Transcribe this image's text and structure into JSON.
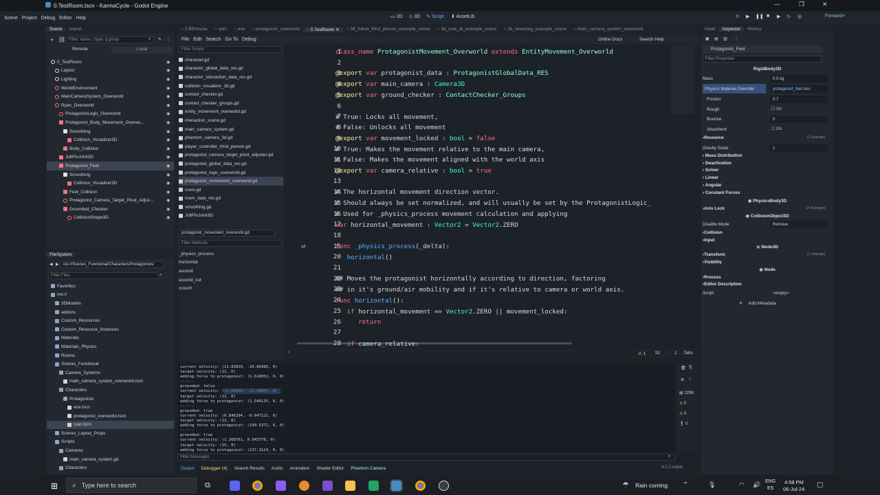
{
  "window": {
    "title": "0.TestRoom.tscn - KarmaCycle - Godot Engine"
  },
  "menu": [
    "Scene",
    "Project",
    "Debug",
    "Editor",
    "Help"
  ],
  "workspaces": [
    "2D",
    "3D",
    "Script",
    "AssetLib"
  ],
  "renderer": "Forward+",
  "scene_dock": {
    "tabs": [
      "Scene",
      "Import"
    ],
    "filter_placeholder": "Filter: name, t:type, g:group",
    "remote": "Remote",
    "local": "Local",
    "nodes": [
      {
        "label": "0_TestRoom",
        "indent": 0,
        "color": "#e0e0e0",
        "circle": true
      },
      {
        "label": "Layout",
        "indent": 1,
        "color": "#e0e0e0",
        "circle": true
      },
      {
        "label": "Lighting",
        "indent": 1,
        "color": "#e0e0e0",
        "circle": true
      },
      {
        "label": "WorldEnvironment",
        "indent": 1,
        "color": "#ff7085",
        "circle": true
      },
      {
        "label": "MainCameraSystem_Overworld",
        "indent": 1,
        "color": "#ff7085",
        "circle": true
      },
      {
        "label": "Ryan_Overworld",
        "indent": 1,
        "color": "#ff7085",
        "circle": true
      },
      {
        "label": "ProtagonistLogic_Overworld",
        "indent": 2,
        "color": "#ff7085",
        "circle": true
      },
      {
        "label": "Protagonist_Body_Movement_Overwo...",
        "indent": 2,
        "color": "#ff7085",
        "circle": false
      },
      {
        "label": "Smoothing",
        "indent": 3,
        "color": "#e0e0e0",
        "circle": false
      },
      {
        "label": "Collision_Visualizer3D",
        "indent": 4,
        "color": "#ff7085",
        "circle": false
      },
      {
        "label": "Body_Collision",
        "indent": 3,
        "color": "#ff7085",
        "circle": false
      },
      {
        "label": "JoltPinJoint3D",
        "indent": 2,
        "color": "#ff7085",
        "circle": false
      },
      {
        "label": "Protagonist_Feet",
        "indent": 2,
        "color": "#ff7085",
        "circle": false,
        "selected": true
      },
      {
        "label": "Smoothing",
        "indent": 3,
        "color": "#e0e0e0",
        "circle": false
      },
      {
        "label": "Collision_Visualizer3D",
        "indent": 4,
        "color": "#ff7085",
        "circle": false
      },
      {
        "label": "Feet_Collision",
        "indent": 3,
        "color": "#ff7085",
        "circle": false
      },
      {
        "label": "Protagonist_Camera_Target_Pivot_Adjus...",
        "indent": 3,
        "color": "#ff7085",
        "circle": true
      },
      {
        "label": "Grounded_Checker",
        "indent": 3,
        "color": "#ff7085",
        "circle": false
      },
      {
        "label": "CollisionShape3D",
        "indent": 4,
        "color": "#ff7085",
        "circle": true
      }
    ]
  },
  "filesystem": {
    "tab": "FileSystem",
    "path": "res://Scenes_Functional/Characters/Protagonists/",
    "filter_placeholder": "Filter Files",
    "items": [
      {
        "label": "Favorites:",
        "indent": 0
      },
      {
        "label": "res://",
        "indent": 0
      },
      {
        "label": "3DModels",
        "indent": 1
      },
      {
        "label": "addons",
        "indent": 1
      },
      {
        "label": "Custom_Resources",
        "indent": 1
      },
      {
        "label": "Custom_Resource_Instances",
        "indent": 1
      },
      {
        "label": "Materials",
        "indent": 1
      },
      {
        "label": "Materials_Physics",
        "indent": 1
      },
      {
        "label": "Rooms",
        "indent": 1
      },
      {
        "label": "Scenes_Functional",
        "indent": 1
      },
      {
        "label": "Camera_Systems",
        "indent": 2
      },
      {
        "label": "main_camera_system_overworld.tscn",
        "indent": 3
      },
      {
        "label": "Characters",
        "indent": 2
      },
      {
        "label": "Protagonists",
        "indent": 3
      },
      {
        "label": "ece.tscn",
        "indent": 4
      },
      {
        "label": "protagonist_overworld.tscn",
        "indent": 4
      },
      {
        "label": "ryan.tscn",
        "indent": 4,
        "selected": true
      },
      {
        "label": "Scenes_Layout_Props",
        "indent": 1
      },
      {
        "label": "Scripts",
        "indent": 1
      },
      {
        "label": "Cameras",
        "indent": 2
      },
      {
        "label": "main_camera_system.gd",
        "indent": 3
      },
      {
        "label": "Characters",
        "indent": 2
      }
    ]
  },
  "editor_tabs": [
    "1.BEHouse",
    "ryan",
    "ece",
    "protagonist_overworld",
    "0.TestRoom",
    "3d_follow_third_person_example_scene",
    "3d_look_at_example_scene",
    "3d_tweening_example_scene",
    "main_camera_system_overworld"
  ],
  "script_menu": [
    "File",
    "Edit",
    "Search",
    "Go To",
    "Debug"
  ],
  "online_docs": "Online Docs",
  "search_help": "Search Help",
  "scripts": {
    "filter_placeholder": "Filter Scripts",
    "list": [
      "character.gd",
      "character_global_data_res.gd",
      "character_interaction_data_res.gd",
      "collision_visualizer_3d.gd",
      "contact_checker.gd",
      "contact_checker_groups.gd",
      "entity_movement_overworld.gd",
      "interaction_scene.gd",
      "main_camera_system.gd",
      "phantom_camera_3d.gd",
      "player_controller_third_person.gd",
      "protagonist_camera_target_pivot_adjuster.gd",
      "protagonist_global_data_res.gd",
      "protagonist_logic_overworld.gd",
      "protagonist_movement_overworld.gd",
      "room.gd",
      "room_data_res.gd",
      "smoothing.gd",
      "JoltPinJoint3D"
    ],
    "current": "protagonist_movement_overworld.gd",
    "methods_placeholder": "Filter Methods",
    "methods": [
      "_physics_process",
      "horizontal",
      "ascend",
      "ascend_cut",
      "crouch"
    ]
  },
  "code": {
    "line_numbers": [
      "1",
      "2",
      "3",
      "4",
      "5",
      "6",
      "7",
      "8",
      "9",
      "10",
      "11",
      "12",
      "13",
      "14",
      "15",
      "16",
      "17",
      "18",
      "19",
      "20",
      "21",
      "22",
      "23",
      "24",
      "25",
      "26",
      "27",
      "28"
    ],
    "status": {
      "warnings": "1",
      "line": "92",
      "col": "1",
      "indent": "Tabs"
    }
  },
  "console": {
    "lines": [
      "current velocity: (11.83819, -20.86985, 0)",
      "target velocity: (12, 0)",
      "adding force to protagonist: (1.618052, 0, 0)",
      "------",
      "grounded: false",
      "current velocity: (11.84539, -22.49805, 0)",
      "target velocity: (12, 0)",
      "adding force to protagonist: (1.546135, 0, 0)",
      "------",
      "grounded: true",
      "current velocity: (0.846294, -0.047121, 0)",
      "target velocity: (12, 0)",
      "adding force to protagonist: (149.5371, 0, 0)",
      "------",
      "grounded: true",
      "current velocity: (1.268761, 0.043778, 0)",
      "target velocity: (15, 0)",
      "adding force to protagonist: (137.3124, 0, 0)"
    ],
    "filter_placeholder": "Filter Messages",
    "counts": [
      "2298",
      "0",
      "0",
      "0"
    ]
  },
  "bottom_tabs": [
    "Output",
    "Debugger (4)",
    "Search Results",
    "Audio",
    "Animation",
    "Shader Editor",
    "Phantom Camera"
  ],
  "version": "4.2.2.stable",
  "inspector": {
    "tabs": [
      "Node",
      "Inspector",
      "History"
    ],
    "node": "Protagonist_Feet",
    "filter_placeholder": "Filter Properties",
    "class": "RigidBody3D",
    "mass_label": "Mass",
    "mass": "0.5 kg",
    "pm_label": "Physics Material Override",
    "pm_value": "protagonist_feet.tres",
    "friction_label": "Friction",
    "friction": "0.7",
    "rough_label": "Rough",
    "rough": "On",
    "bounce_label": "Bounce",
    "bounce": "0",
    "absorbent_label": "Absorbent",
    "absorbent": "On",
    "resource": "Resource",
    "changes": "(1 change)",
    "gravity_label": "Gravity Scale",
    "gravity": "1",
    "sections_rb": [
      "Mass Distribution",
      "Deactivation",
      "Solver",
      "Linear",
      "Angular",
      "Constant Forces"
    ],
    "physics_body": "PhysicsBody3D",
    "axis_lock": "Axis Lock",
    "axis_changes": "(3 changes)",
    "collision_object": "CollisionObject3D",
    "disable_label": "Disable Mode",
    "disable": "Remove",
    "sections_co": [
      "Collision",
      "Input"
    ],
    "node3d": "Node3D",
    "transform": "Transform",
    "transform_changes": "(1 change)",
    "visibility": "Visibility",
    "node_class": "Node",
    "process": "Process",
    "editor_desc": "Editor Description",
    "script_label": "Script",
    "script_value": "<empty>",
    "add_meta": "Add Metadata"
  },
  "taskbar": {
    "search": "Type here to search",
    "weather": "Rain coming",
    "lang": "ENG",
    "lang2": "ES",
    "time": "4:58 PM",
    "date": "06-Jul-24"
  }
}
